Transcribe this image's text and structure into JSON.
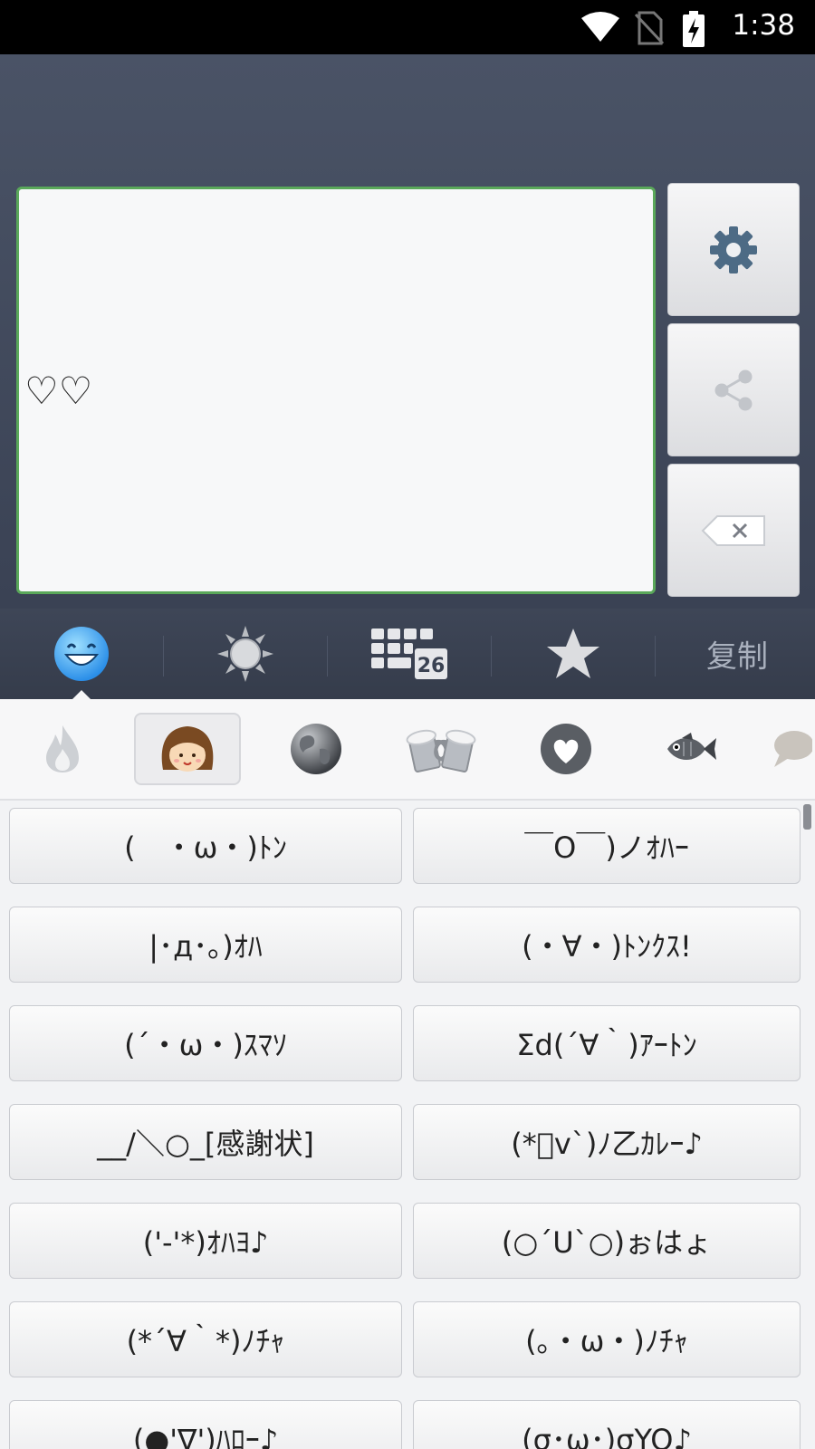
{
  "status_bar": {
    "time": "1:38",
    "icons": [
      "wifi-icon",
      "no-sim-icon",
      "battery-charging-icon"
    ]
  },
  "editor": {
    "text": "♡♡"
  },
  "side_buttons": [
    {
      "name": "settings-button",
      "icon": "gear-icon"
    },
    {
      "name": "share-button",
      "icon": "share-icon"
    },
    {
      "name": "backspace-button",
      "icon": "backspace-icon"
    }
  ],
  "tabs": [
    {
      "name": "tab-emoji",
      "icon": "smiley-face-icon",
      "selected": true
    },
    {
      "name": "tab-symbols",
      "icon": "sun-icon"
    },
    {
      "name": "tab-keyboard",
      "icon": "keyboard-icon",
      "badge": "26"
    },
    {
      "name": "tab-favorites",
      "icon": "star-icon"
    },
    {
      "name": "tab-copy",
      "label": "复制"
    }
  ],
  "subcategories": [
    {
      "name": "fire-icon"
    },
    {
      "name": "girl-face-icon",
      "selected": true
    },
    {
      "name": "globe-icon"
    },
    {
      "name": "beer-mugs-icon"
    },
    {
      "name": "heart-icon"
    },
    {
      "name": "fish-icon"
    },
    {
      "name": "speech-bubble-icon"
    }
  ],
  "kaomoji": [
    [
      "(　・ω・)ﾄﾝ",
      "￣O￣)ノｵﾊｰ"
    ],
    [
      "|･д･｡)ｵﾊ",
      "(・∀・)ﾄﾝｸｽ!"
    ],
    [
      "(´・ω・)ｽﾏｿ",
      "Σd(´∀｀)ｱｰﾄﾝ"
    ],
    [
      "__/＼○_[感謝状]",
      "(*ﾟv`)ﾉ乙ｶﾚｰ♪"
    ],
    [
      "('-'*)ｵﾊﾖ♪",
      "(○´U`○)ぉはょ"
    ],
    [
      "(*´∀｀*)ﾉﾁｬ",
      "(｡・ω・)ﾉﾁｬ"
    ],
    [
      "(●'∇')ﾊﾛｰ♪",
      "(σ･ω･)σYO♪"
    ]
  ],
  "colors": {
    "header": "#3f4759",
    "accent_green": "#5aa85a",
    "list_bg": "#f2f3f5"
  }
}
